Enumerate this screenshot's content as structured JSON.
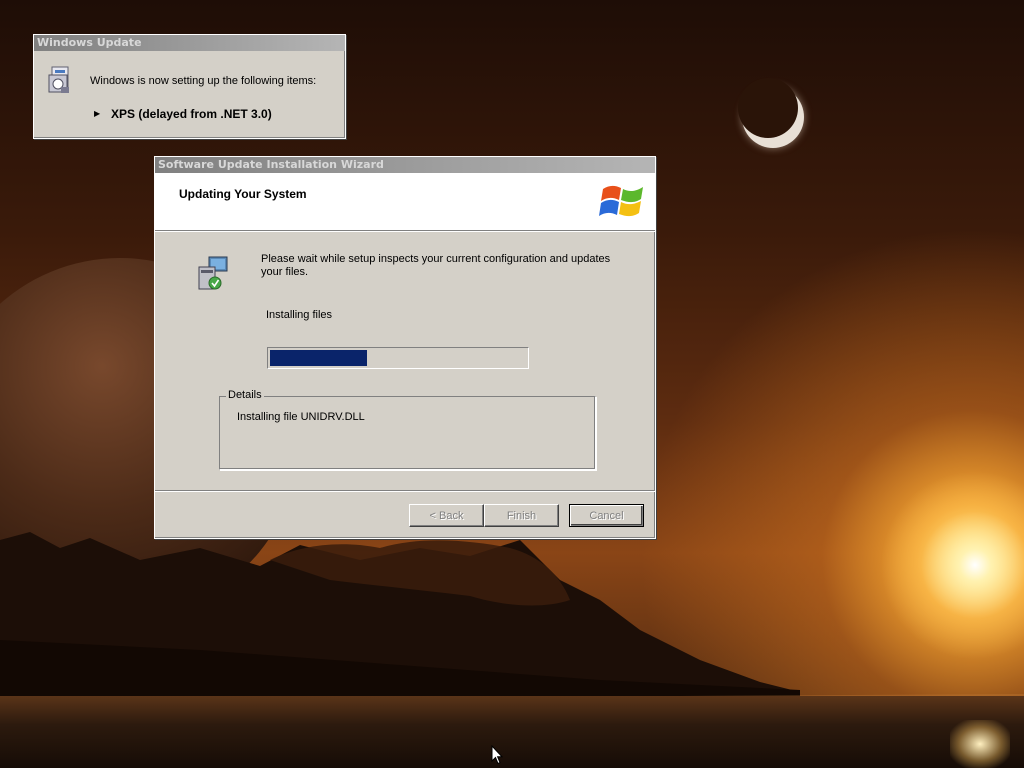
{
  "colors": {
    "titlebar_inactive": "#808080",
    "window_face": "#d4d0c8",
    "progress_fill": "#0a246a"
  },
  "windows_update": {
    "title": "Windows Update",
    "message": "Windows is now setting up the following items:",
    "items": [
      {
        "label": "XPS (delayed from .NET 3.0)"
      }
    ],
    "icon": "update-package-icon"
  },
  "wizard": {
    "title": "Software Update Installation Wizard",
    "heading": "Updating Your System",
    "logo": "windows-logo-icon",
    "setup_icon": "setup-computer-icon",
    "wait_message": "Please wait while setup inspects your current configuration and updates your files.",
    "status": "Installing files",
    "progress_percent": 38,
    "details_label": "Details",
    "details_text": "Installing file UNIDRV.DLL",
    "buttons": {
      "back": "< Back",
      "finish": "Finish",
      "cancel": "Cancel"
    }
  },
  "cursor": "mouse-pointer-icon"
}
